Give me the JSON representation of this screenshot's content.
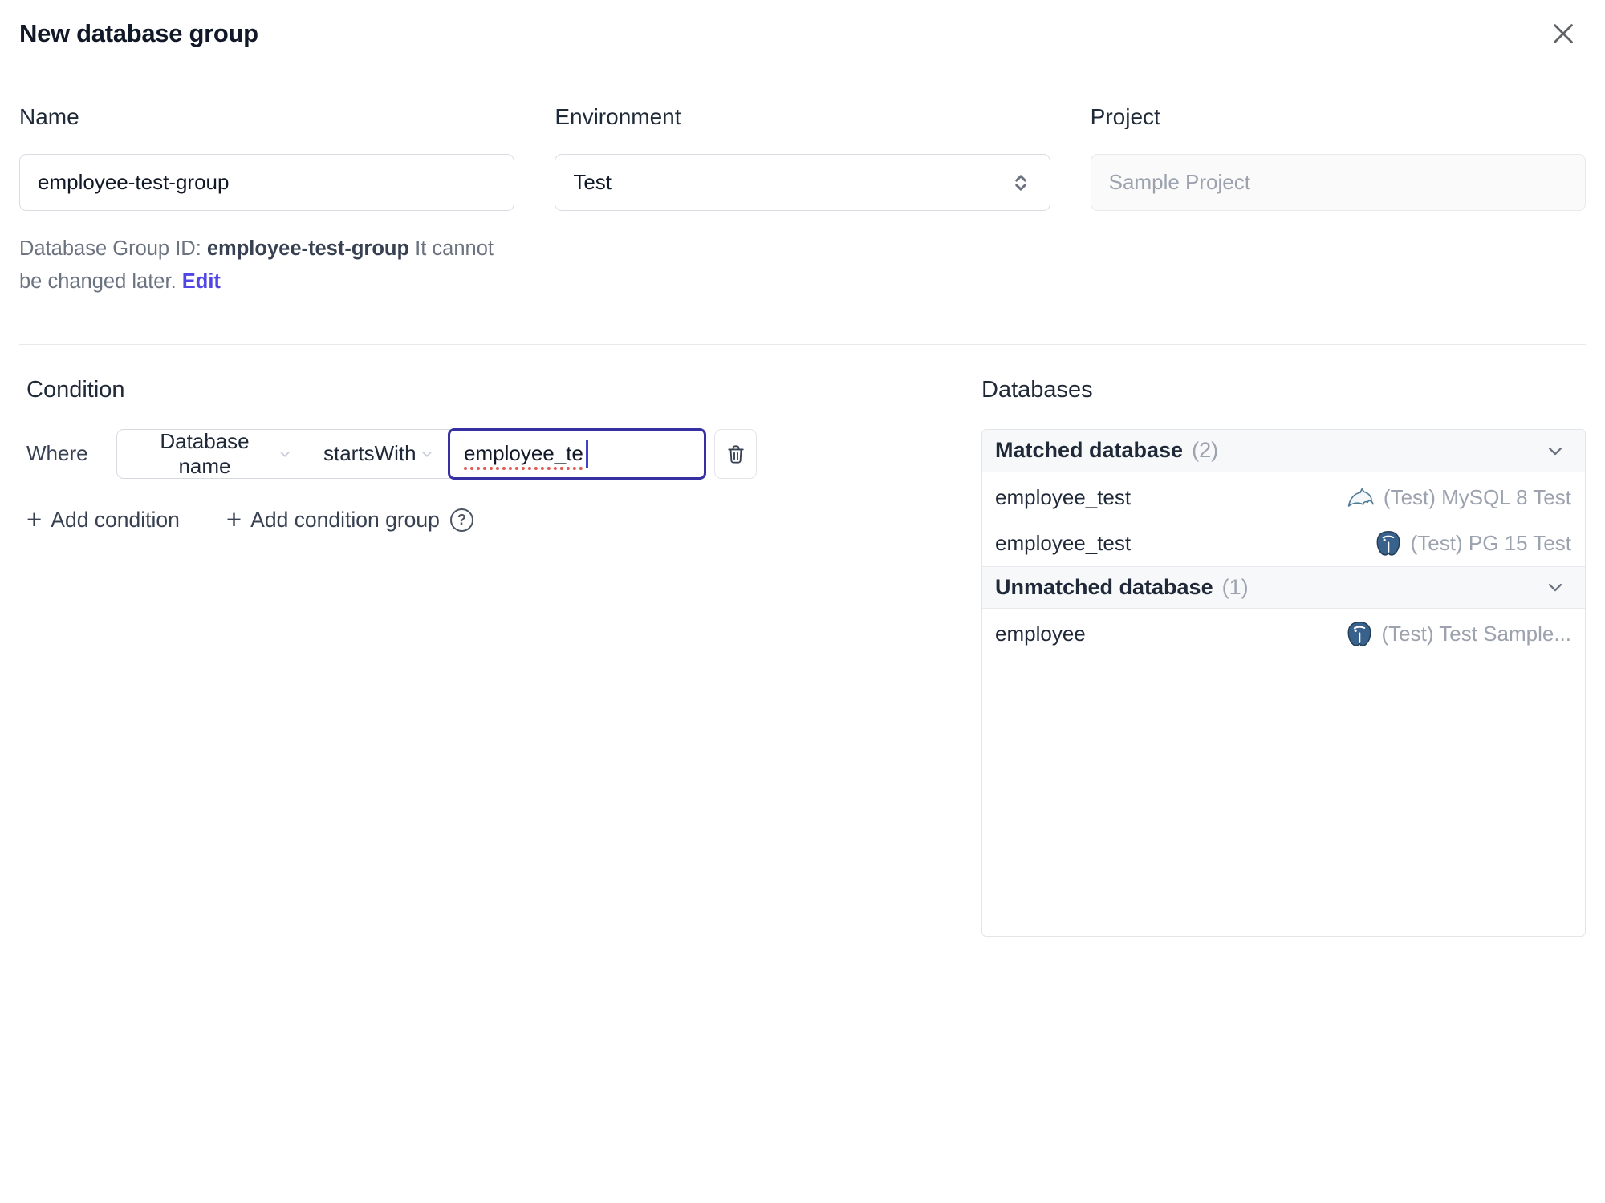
{
  "dialog": {
    "title": "New database group"
  },
  "icons": {
    "plus": "+",
    "help": "?"
  },
  "form": {
    "name": {
      "label": "Name",
      "value": "employee-test-group",
      "helper_prefix": "Database Group ID: ",
      "helper_id": "employee-test-group",
      "helper_suffix": " It cannot be changed later. ",
      "edit_link": "Edit"
    },
    "environment": {
      "label": "Environment",
      "selected": "Test"
    },
    "project": {
      "label": "Project",
      "value": "Sample Project"
    }
  },
  "condition": {
    "heading": "Condition",
    "where_label": "Where",
    "factor": "Database name",
    "operator": "startsWith",
    "value": "employee_te",
    "add_condition": "Add condition",
    "add_condition_group": "Add condition group"
  },
  "databases": {
    "heading": "Databases",
    "matched": {
      "title": "Matched database",
      "count": "(2)",
      "rows": [
        {
          "name": "employee_test",
          "engine": "mysql",
          "instance": "(Test) MySQL 8 Test"
        },
        {
          "name": "employee_test",
          "engine": "postgres",
          "instance": "(Test) PG 15 Test"
        }
      ]
    },
    "unmatched": {
      "title": "Unmatched database",
      "count": "(1)",
      "rows": [
        {
          "name": "employee",
          "engine": "postgres",
          "instance": "(Test) Test Sample..."
        }
      ]
    }
  },
  "colors": {
    "accent": "#4f46e5",
    "focus_border": "#3730a3",
    "muted_text": "#9ca3af",
    "mysql_brand": "#4e7a94",
    "postgres_brand": "#38618c"
  }
}
